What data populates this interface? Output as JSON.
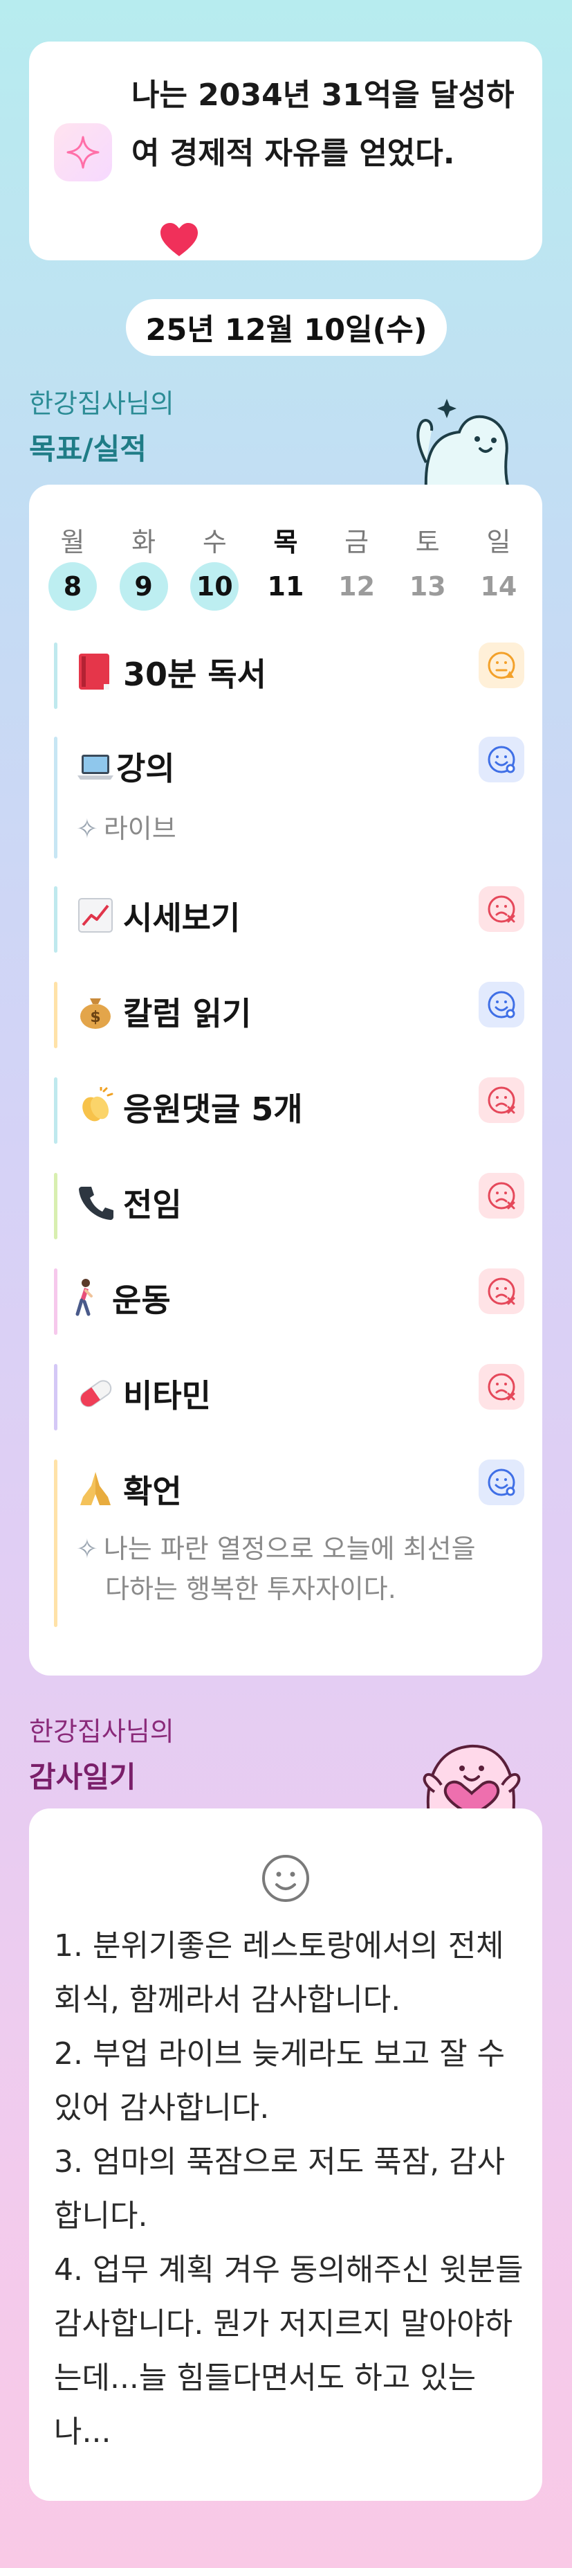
{
  "affirmation": {
    "text": "나는 2034년 31억을 달성하여 경제적 자유를 얻었다.",
    "heart": "❤️"
  },
  "date_label": "25년 12월 10일(수)",
  "goals_section": {
    "owner": "한강집사님의",
    "title": "목표/실적"
  },
  "week": [
    {
      "name": "월",
      "date": "8",
      "state": "done"
    },
    {
      "name": "화",
      "date": "9",
      "state": "done"
    },
    {
      "name": "수",
      "date": "10",
      "state": "done"
    },
    {
      "name": "목",
      "date": "11",
      "state": "today"
    },
    {
      "name": "금",
      "date": "12",
      "state": "future"
    },
    {
      "name": "토",
      "date": "13",
      "state": "future"
    },
    {
      "name": "일",
      "date": "14",
      "state": "future"
    }
  ],
  "tasks": [
    {
      "emoji": "📕",
      "title": "30분 독서",
      "status": "warning",
      "bar": "#bfe9ee"
    },
    {
      "emoji": "💻",
      "title": "강의",
      "note": "라이브",
      "status": "happy",
      "bar": "#c7e6f4"
    },
    {
      "emoji": "📈",
      "title": "시세보기",
      "status": "sad",
      "bar": "#bfe9ee"
    },
    {
      "emoji": "💰",
      "title": "칼럼 읽기",
      "status": "happy",
      "bar": "#ffe2a8"
    },
    {
      "emoji": "👏",
      "title": "응원댓글 5개",
      "status": "sad",
      "bar": "#bfe9ee"
    },
    {
      "emoji": "📞",
      "title": "전임",
      "status": "sad",
      "bar": "#d8efb0"
    },
    {
      "emoji": "🚶",
      "title": "운동",
      "status": "sad",
      "bar": "#f6c8ec"
    },
    {
      "emoji": "💊",
      "title": "비타민",
      "status": "sad",
      "bar": "#d4c8f6"
    },
    {
      "emoji": "🙏",
      "title": "확언",
      "note": "나는 파란 열정으로 오늘에 최선을 다하는 행복한 투자자이다.",
      "status": "happy",
      "bar": "#ffe2a8"
    }
  ],
  "gratitude_section": {
    "owner": "한강집사님의",
    "title": "감사일기"
  },
  "gratitude": [
    "1. 분위기좋은 레스토랑에서의 전체 회식, 함께라서 감사합니다.",
    "2. 부업 라이브 늦게라도 보고 잘 수 있어 감사합니다.",
    "3. 엄마의 푹잠으로 저도 푹잠, 감사합니다.",
    "4. 업무 계획 겨우 동의해주신 윗분들 감사합니다. 뭔가 저지르지 말아야하는데...늘 힘들다면서도 하고 있는 나..."
  ],
  "colors": {
    "goals_owner": "#2b8c95",
    "goals_title": "#1f7c86",
    "gratitude_owner": "#8a2a7a",
    "gratitude_title": "#7a1f6a"
  }
}
